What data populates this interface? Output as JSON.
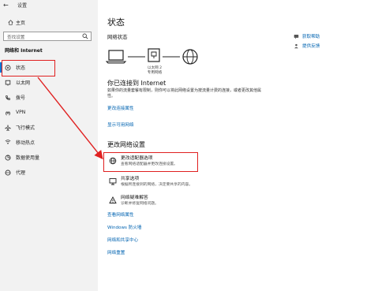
{
  "window": {
    "title": "设置",
    "back_glyph": "←"
  },
  "sidebar": {
    "home_label": "主页",
    "search_placeholder": "查找设置",
    "section_title": "网络和 Internet",
    "items": [
      {
        "label": "状态",
        "icon": "status-icon",
        "active": true
      },
      {
        "label": "以太网",
        "icon": "ethernet-icon"
      },
      {
        "label": "拨号",
        "icon": "dialup-icon"
      },
      {
        "label": "VPN",
        "icon": "vpn-icon"
      },
      {
        "label": "飞行模式",
        "icon": "airplane-icon"
      },
      {
        "label": "移动热点",
        "icon": "hotspot-icon"
      },
      {
        "label": "数据使用量",
        "icon": "data-usage-icon"
      },
      {
        "label": "代理",
        "icon": "proxy-icon"
      }
    ]
  },
  "main": {
    "title": "状态",
    "network_status_label": "网络状态",
    "diagram_label_line1": "以太网 2",
    "diagram_label_line2": "专用网络",
    "connected_title": "你已连接到 Internet",
    "description": "如果你的流量套餐有限制，则你可以将此网络设置为按流量计费的连接，或者更改其他属性。",
    "link_change_props": "更改连接属性",
    "link_show_networks": "显示可用网络",
    "change_settings_title": "更改网络设置",
    "options": [
      {
        "title": "更改适配器选项",
        "subtitle": "查看网络适配器并更改连接设置。",
        "icon": "adapter-icon"
      },
      {
        "title": "共享选项",
        "subtitle": "根据所连接到的网络，决定要共享的内容。",
        "icon": "sharing-icon"
      },
      {
        "title": "网络疑难解答",
        "subtitle": "诊断并修复网络问题。",
        "icon": "troubleshoot-icon"
      }
    ],
    "bottom_links": [
      "查看网络属性",
      "Windows 防火墙",
      "网络和共享中心",
      "网络重置"
    ]
  },
  "help": {
    "get_help": "获取帮助",
    "feedback": "提供反馈"
  },
  "colors": {
    "accent": "#0078d7",
    "link": "#0063b1",
    "highlight": "#e02020"
  }
}
